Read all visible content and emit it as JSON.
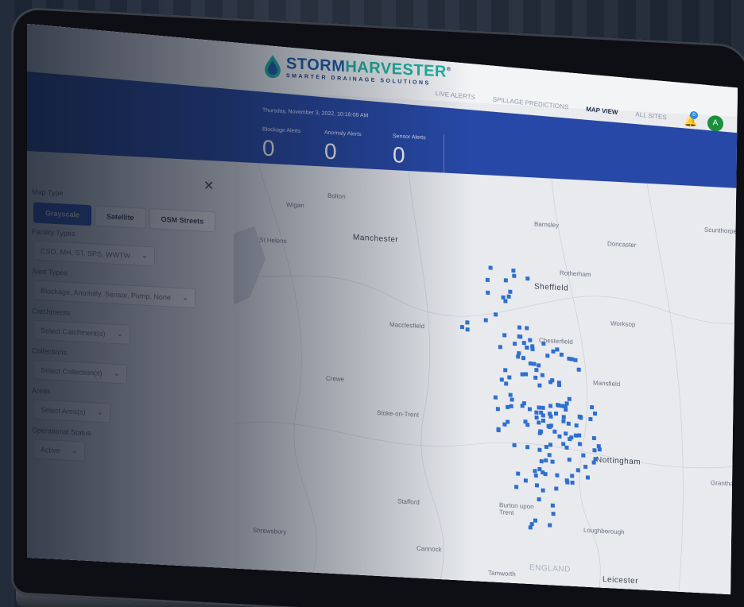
{
  "logo": {
    "name_part1": "STORM",
    "name_part2": "HARVESTER",
    "tagline": "SMARTER DRAINAGE SOLUTIONS",
    "trademark": "®"
  },
  "nav": [
    {
      "label": "LIVE ALERTS",
      "active": false
    },
    {
      "label": "SPILLAGE PREDICTIONS",
      "active": false
    },
    {
      "label": "MAP VIEW",
      "active": true
    },
    {
      "label": "ALL SITES",
      "active": false
    }
  ],
  "header": {
    "notifications_count": "0",
    "avatar_initial": "A"
  },
  "alerts": {
    "date": "Thursday, November 3, 2022, 10:16:08 AM",
    "blockage_label": "Blockage Alerts",
    "blockage_value": "0",
    "anomaly_label": "Anomaly Alerts",
    "anomaly_value": "0",
    "sensor_label": "Sensor Alerts",
    "sensor_value": "0"
  },
  "sidebar": {
    "close": "✕",
    "map_type_label": "Map Type",
    "map_types": [
      "Grayscale",
      "Satellite",
      "OSM Streets"
    ],
    "facility_label": "Facility Types",
    "facility_value": "CSO, MH, ST, SPS, WWTW",
    "alert_types_label": "Alert Types",
    "alert_types_value": "Blockage, Anomaly, Sensor, Pump, None",
    "catchments_label": "Catchments",
    "catchments_value": "Select Catchment(s)",
    "collections_label": "Collections",
    "collections_value": "Select Collection(s)",
    "areas_label": "Areas",
    "areas_value": "Select Area(s)",
    "op_status_label": "Operational Status",
    "op_status_value": "Active"
  },
  "map": {
    "cities": [
      {
        "name": "Bolton",
        "size": "small"
      },
      {
        "name": "Wigan",
        "size": "small"
      },
      {
        "name": "Manchester",
        "size": "big"
      },
      {
        "name": "St Helens",
        "size": "small"
      },
      {
        "name": "Barnsley",
        "size": "small"
      },
      {
        "name": "Doncaster",
        "size": "small"
      },
      {
        "name": "Rotherham",
        "size": "small"
      },
      {
        "name": "Sheffield",
        "size": "big"
      },
      {
        "name": "Worksop",
        "size": "small"
      },
      {
        "name": "Chesterfield",
        "size": "small"
      },
      {
        "name": "Macclesfield",
        "size": "small"
      },
      {
        "name": "Mansfield",
        "size": "small"
      },
      {
        "name": "Crewe",
        "size": "small"
      },
      {
        "name": "Stoke-on-Trent",
        "size": "small"
      },
      {
        "name": "Nottingham",
        "size": "big"
      },
      {
        "name": "Stafford",
        "size": "small"
      },
      {
        "name": "Burton upon Trent",
        "size": "small"
      },
      {
        "name": "Loughborough",
        "size": "small"
      },
      {
        "name": "Shrewsbury",
        "size": "small"
      },
      {
        "name": "Cannock",
        "size": "small"
      },
      {
        "name": "ENGLAND",
        "size": "big"
      },
      {
        "name": "Tamworth",
        "size": "small"
      },
      {
        "name": "Leicester",
        "size": "big"
      },
      {
        "name": "Grantham",
        "size": "small"
      },
      {
        "name": "Scunthorpe",
        "size": "small"
      }
    ],
    "marker_color": "#2f6fce"
  }
}
